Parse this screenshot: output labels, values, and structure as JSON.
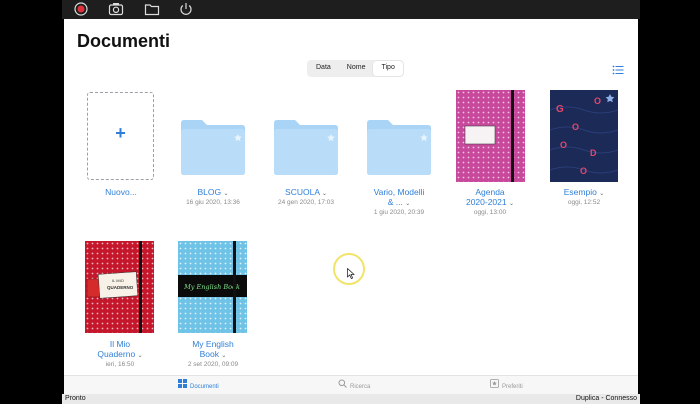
{
  "toolbar": {
    "icons": [
      "record-icon",
      "camera-icon",
      "folder-icon",
      "power-icon"
    ],
    "accent": "#e0303a"
  },
  "header": {
    "title": "Documenti",
    "sort_tabs": [
      {
        "label": "Data",
        "active": false
      },
      {
        "label": "Nome",
        "active": false
      },
      {
        "label": "Tipo",
        "active": true
      }
    ],
    "list_view_icon": "list-icon"
  },
  "items": [
    {
      "name": "Nuovo...",
      "meta": "",
      "kind": "new"
    },
    {
      "name": "BLOG",
      "meta": "16 giu 2020, 13:36",
      "kind": "folder"
    },
    {
      "name": "SCUOLA",
      "meta": "24 gen 2020, 17:03",
      "kind": "folder"
    },
    {
      "name_line1": "Vario, Modelli",
      "name_line2": "& ...",
      "meta": "1 giu 2020, 20:39",
      "kind": "folder"
    },
    {
      "name_line1": "Agenda",
      "name_line2": "2020-2021",
      "meta": "oggi, 13:00",
      "kind": "notebook"
    },
    {
      "name": "Esempio",
      "meta": "oggi, 12:52",
      "kind": "notebook"
    },
    {
      "name_line1": "Il Mio",
      "name_line2": "Quaderno",
      "meta": "ieri, 16:50",
      "kind": "notebook",
      "cover_text1": "IL MIO",
      "cover_text2": "QUADERNO"
    },
    {
      "name_line1": "My English",
      "name_line2": "Book",
      "meta": "2 set 2020, 09:09",
      "kind": "notebook",
      "cover_text": "My English Book"
    }
  ],
  "tabbar": {
    "tabs": [
      {
        "label": "Documenti",
        "icon": "grid-icon",
        "active": true
      },
      {
        "label": "Ricerca",
        "icon": "search-icon",
        "active": false
      },
      {
        "label": "Preferiti",
        "icon": "star-icon",
        "active": false
      }
    ]
  },
  "status": {
    "left": "Pronto",
    "right": "Duplica - Connesso"
  },
  "colors": {
    "link_blue": "#2f7fd8",
    "folder_blue": "#a9d4f5",
    "agenda_pink": "#c8489c",
    "esempio_navy": "#1b2a57",
    "quaderno_red": "#c4172c",
    "english_cyan": "#6fc3e6"
  }
}
